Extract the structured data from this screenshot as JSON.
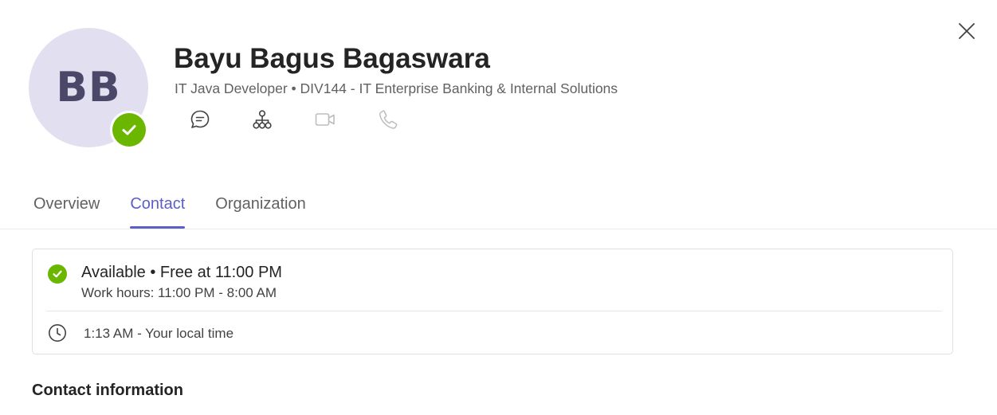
{
  "close": {
    "icon": "close-icon"
  },
  "profile": {
    "initials": "BB",
    "name": "Bayu Bagus Bagaswara",
    "subtitle": "IT Java Developer • DIV144 - IT Enterprise Banking & Internal Solutions",
    "presence_color": "#6bb700",
    "avatar_bg": "#e2dff0"
  },
  "actions": [
    {
      "icon": "chat-icon",
      "enabled": true
    },
    {
      "icon": "org-chart-icon",
      "enabled": true
    },
    {
      "icon": "video-call-icon",
      "enabled": false
    },
    {
      "icon": "phone-call-icon",
      "enabled": false
    }
  ],
  "tabs": [
    {
      "label": "Overview",
      "active": false
    },
    {
      "label": "Contact",
      "active": true
    },
    {
      "label": "Organization",
      "active": false
    }
  ],
  "accent_color": "#5b5fc7",
  "status": {
    "main": "Available • Free at 11:00 PM",
    "work_hours": "Work hours: 11:00 PM - 8:00 AM",
    "local_time": "1:13 AM - Your local time"
  },
  "contact_info": {
    "heading": "Contact information"
  }
}
